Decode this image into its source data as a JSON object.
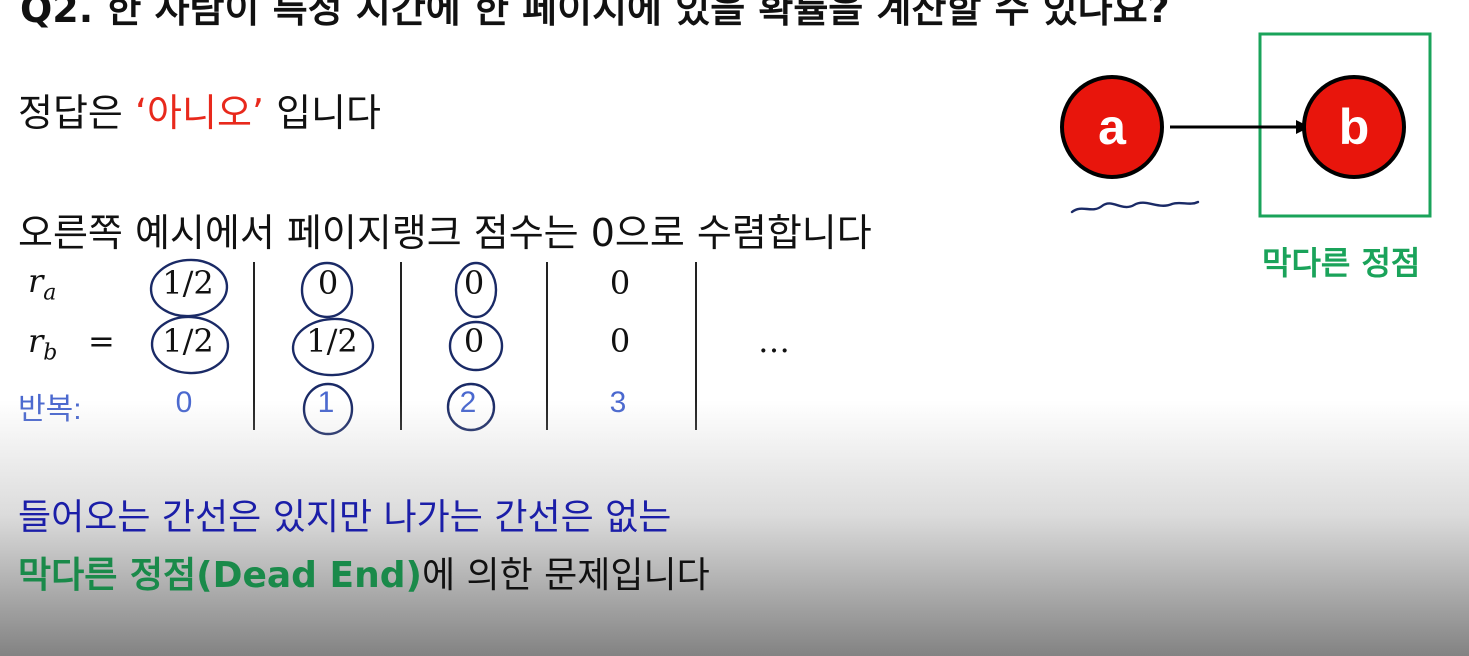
{
  "heading": "Q2. 한 사람이 특정 시간에 한 페이지에 있을 확률을 계산할 수 있나요?",
  "answer_line": {
    "prefix": "정답은 ",
    "answer": "‘아니오’",
    "suffix": " 입니다"
  },
  "explanation": "오른쪽 예시에서 페이지랭크 점수는 0으로 수렴합니다",
  "table": {
    "row_labels": {
      "ra": "r",
      "ra_sub": "a",
      "rb": "r",
      "rb_sub": "b",
      "equals": "=",
      "iter": "반복:"
    },
    "ra_values": [
      "1/2",
      "0",
      "0",
      "0"
    ],
    "rb_values": [
      "1/2",
      "1/2",
      "0",
      "0"
    ],
    "iterations": [
      "0",
      "1",
      "2",
      "3"
    ],
    "ellipsis": "…"
  },
  "graph": {
    "node_a": "a",
    "node_b": "b",
    "box_label": "막다른 정점",
    "node_color": "#e8150c",
    "box_color": "#1aa35a"
  },
  "footer": {
    "line1": "들어오는 간선은 있지만 나가는 간선은 없는",
    "line2_highlight": "막다른 정점(Dead End)",
    "line2_rest": "에 의한 문제입니다"
  }
}
